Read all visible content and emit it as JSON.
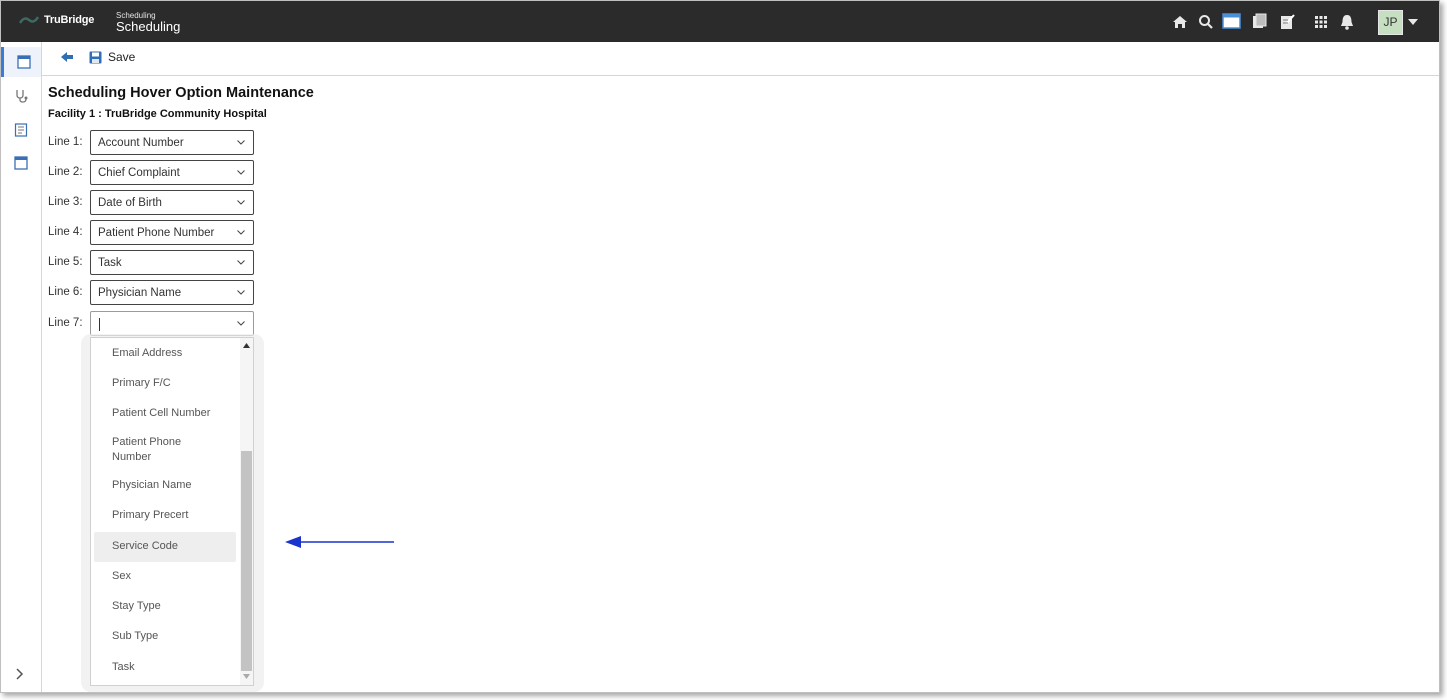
{
  "header": {
    "brand": "TruBridge",
    "module_small": "Scheduling",
    "module_big": "Scheduling",
    "avatar_initials": "JP",
    "icons": [
      "home-icon",
      "search-icon",
      "window-icon",
      "documents-icon",
      "notes-icon",
      "apps-grid-icon",
      "bell-icon"
    ]
  },
  "rail": {
    "items": [
      "calendar-window-icon",
      "stethoscope-icon",
      "report-icon",
      "window-icon"
    ],
    "expand_icon": "chevron-right-icon"
  },
  "toolbar": {
    "save_label": "Save"
  },
  "page": {
    "title": "Scheduling Hover Option Maintenance",
    "facility": "Facility 1 : TruBridge Community Hospital"
  },
  "lines": [
    {
      "label": "Line 1:",
      "value": "Account Number"
    },
    {
      "label": "Line 2:",
      "value": "Chief Complaint"
    },
    {
      "label": "Line 3:",
      "value": "Date of Birth"
    },
    {
      "label": "Line 4:",
      "value": "Patient Phone Number"
    },
    {
      "label": "Line 5:",
      "value": "Task"
    },
    {
      "label": "Line 6:",
      "value": "Physician Name"
    },
    {
      "label": "Line 7:",
      "value": ""
    }
  ],
  "dropdown": {
    "options": [
      "Email Address",
      "Primary F/C",
      "Patient Cell Number",
      "Patient Phone Number",
      "Physician Name",
      "Primary Precert",
      "Service Code",
      "Sex",
      "Stay Type",
      "Sub Type",
      "Task"
    ],
    "highlighted": "Service Code"
  },
  "colors": {
    "header_bg": "#2b2b2b",
    "avatar_bg": "#c6dfc0",
    "accent": "#3a7bd5",
    "annotation_arrow": "#1a33cc"
  }
}
